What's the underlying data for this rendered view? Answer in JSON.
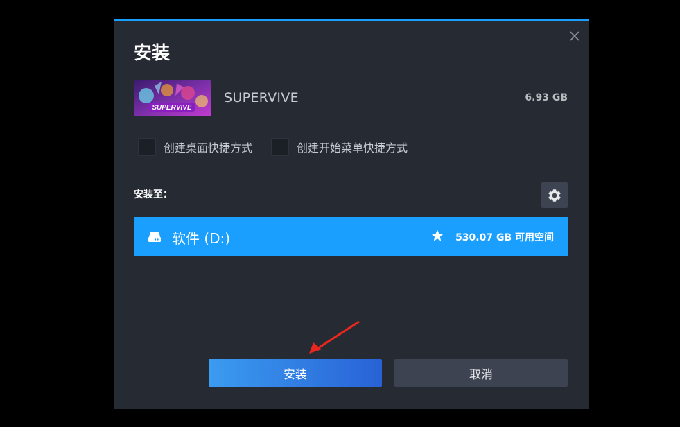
{
  "dialog": {
    "title": "安装",
    "close_icon": "close-icon",
    "accent_color": "#1a9fff"
  },
  "game": {
    "name": "SUPERVIVE",
    "size": "6.93 GB",
    "thumbnail_text": "SUPERVIVE"
  },
  "options": {
    "desktop_shortcut_label": "创建桌面快捷方式",
    "desktop_shortcut_checked": false,
    "start_menu_shortcut_label": "创建开始菜单快捷方式",
    "start_menu_shortcut_checked": false
  },
  "install_location": {
    "label": "安装至：",
    "settings_icon": "gear-icon",
    "drive_icon": "hard-drive-icon",
    "drive_name": "软件 (D:)",
    "default_icon": "star-icon",
    "free_space": "530.07 GB 可用空间"
  },
  "buttons": {
    "install_label": "安装",
    "cancel_label": "取消"
  }
}
